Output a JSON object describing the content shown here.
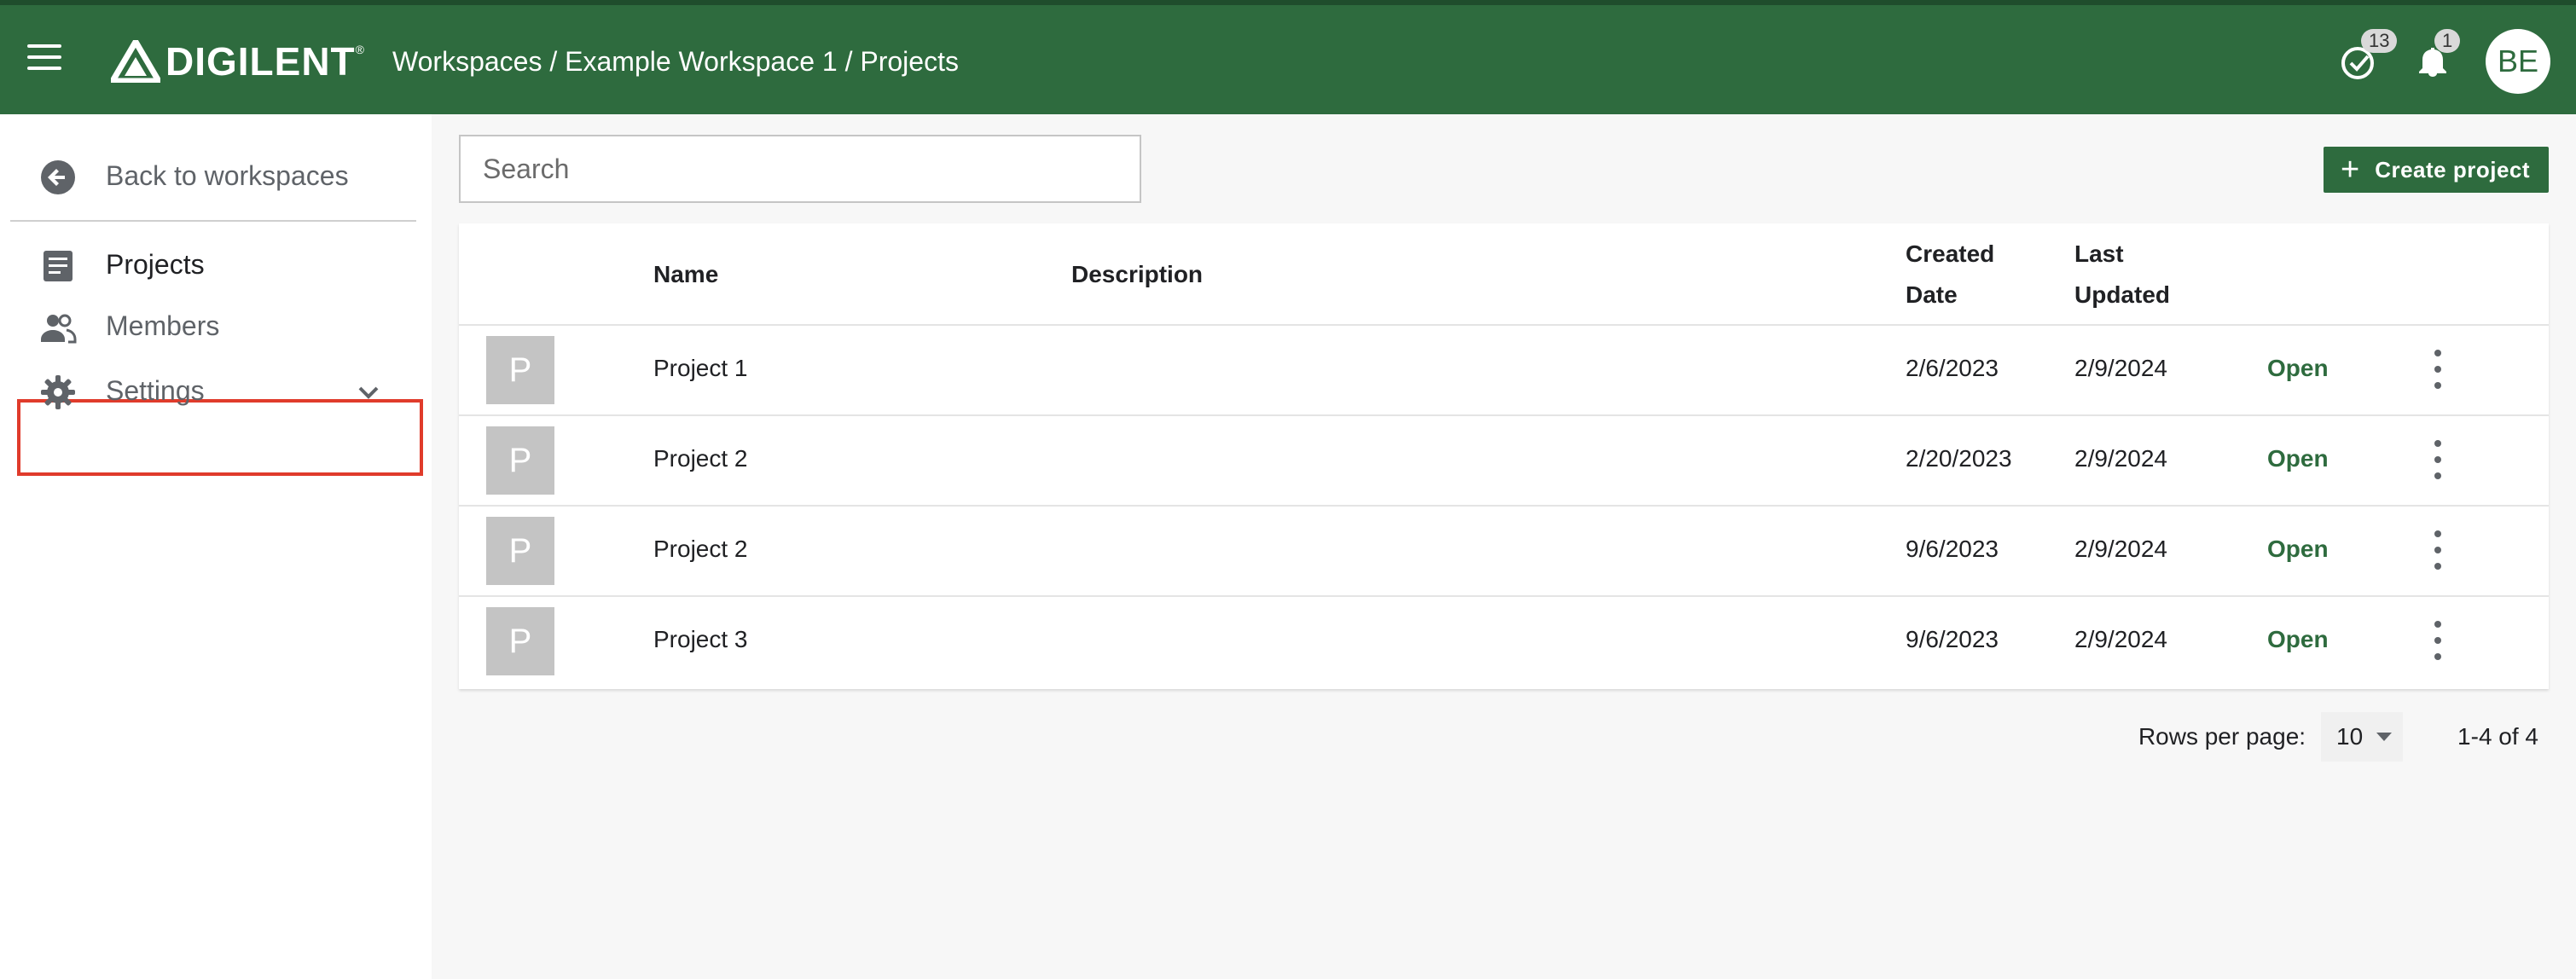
{
  "header": {
    "logo_text": "DIGILENT",
    "logo_mark": "®",
    "breadcrumb": [
      "Workspaces",
      "Example Workspace 1",
      "Projects"
    ],
    "breadcrumb_separator": " / ",
    "tasks_badge": "13",
    "notifications_badge": "1",
    "avatar_initials": "BE",
    "brand_color": "#2e6b3e"
  },
  "sidebar": {
    "back_label": "Back to workspaces",
    "items": [
      {
        "label": "Projects",
        "icon": "document-icon",
        "active": true
      },
      {
        "label": "Members",
        "icon": "people-icon",
        "highlighted": true
      },
      {
        "label": "Settings",
        "icon": "gear-icon",
        "expandable": true
      }
    ]
  },
  "toolbar": {
    "search_placeholder": "Search",
    "create_label": "Create project"
  },
  "table": {
    "columns": {
      "name": "Name",
      "description": "Description",
      "created_line1": "Created",
      "created_line2": "Date",
      "updated_line1": "Last",
      "updated_line2": "Updated"
    },
    "rows": [
      {
        "thumb": "P",
        "name": "Project 1",
        "description": "",
        "created": "2/6/2023",
        "updated": "2/9/2024",
        "action": "Open"
      },
      {
        "thumb": "P",
        "name": "Project 2",
        "description": "",
        "created": "2/20/2023",
        "updated": "2/9/2024",
        "action": "Open"
      },
      {
        "thumb": "P",
        "name": "Project 2",
        "description": "",
        "created": "9/6/2023",
        "updated": "2/9/2024",
        "action": "Open"
      },
      {
        "thumb": "P",
        "name": "Project 3",
        "description": "",
        "created": "9/6/2023",
        "updated": "2/9/2024",
        "action": "Open"
      }
    ]
  },
  "pagination": {
    "rows_per_page_label": "Rows per page:",
    "rows_per_page_value": "10",
    "range_label": "1-4 of 4"
  }
}
